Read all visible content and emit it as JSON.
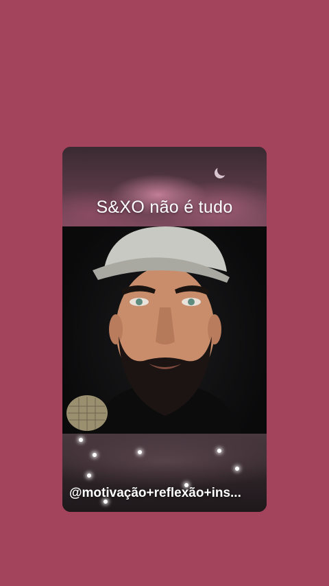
{
  "post": {
    "title": "S&XO não é tudo",
    "handle": "@motivação+reflexão+ins..."
  },
  "colors": {
    "background": "#a4435c",
    "text": "#ffffff"
  }
}
